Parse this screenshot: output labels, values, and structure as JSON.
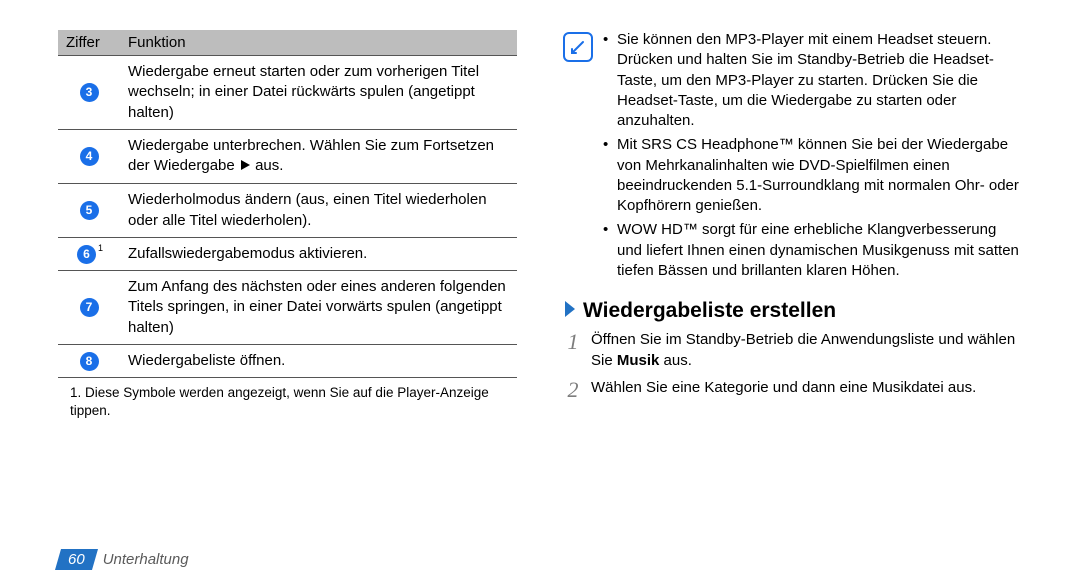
{
  "table": {
    "headers": [
      "Ziffer",
      "Funktion"
    ],
    "rows": [
      {
        "num": "3",
        "sup": "",
        "text": "Wiedergabe erneut starten oder zum vorherigen Titel wechseln; in einer Datei rückwärts spulen (angetippt halten)"
      },
      {
        "num": "4",
        "sup": "",
        "text_pre": "Wiedergabe unterbrechen. Wählen Sie zum Fortsetzen der Wiedergabe ",
        "text_post": " aus.",
        "has_play": true
      },
      {
        "num": "5",
        "sup": "",
        "text": "Wiederholmodus ändern (aus, einen Titel wiederholen oder alle Titel wiederholen)."
      },
      {
        "num": "6",
        "sup": "1",
        "text": "Zufallswiedergabemodus aktivieren."
      },
      {
        "num": "7",
        "sup": "",
        "text": "Zum Anfang des nächsten oder eines anderen folgenden Titels springen, in einer Datei vorwärts spulen (angetippt halten)"
      },
      {
        "num": "8",
        "sup": "",
        "text": "Wiedergabeliste öffnen."
      }
    ]
  },
  "footnote": "1.  Diese Symbole werden angezeigt, wenn Sie auf die Player-Anzeige tippen.",
  "note": {
    "bullets": [
      "Sie können den MP3-Player mit einem Headset steuern. Drücken und halten Sie im Standby-Betrieb die Headset-Taste, um den MP3-Player zu starten. Drücken Sie die Headset-Taste, um die Wiedergabe zu starten oder anzuhalten.",
      "Mit SRS CS Headphone™ können Sie bei der Wiedergabe von Mehrkanalinhalten wie DVD-Spielfilmen einen beeindruckenden 5.1-Surroundklang mit normalen Ohr- oder Kopfhörern genießen.",
      "WOW HD™ sorgt für eine erhebliche Klangverbesserung und liefert Ihnen einen dynamischen Musikgenuss mit satten tiefen Bässen und brillanten klaren Höhen."
    ]
  },
  "section_title": "Wiedergabeliste erstellen",
  "steps": [
    {
      "num": "1",
      "text_pre": "Öffnen Sie im Standby-Betrieb die Anwendungsliste und wählen Sie ",
      "bold": "Musik",
      "text_post": " aus."
    },
    {
      "num": "2",
      "text_pre": "Wählen Sie eine Kategorie und dann eine Musikdatei aus.",
      "bold": "",
      "text_post": ""
    }
  ],
  "footer": {
    "page": "60",
    "label": "Unterhaltung"
  }
}
